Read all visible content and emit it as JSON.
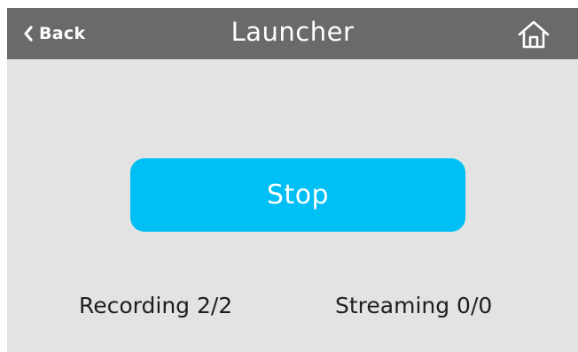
{
  "header": {
    "back_label": "Back",
    "title": "Launcher",
    "back_icon": "chevron-left-icon",
    "home_icon": "home-icon"
  },
  "main": {
    "stop_label": "Stop"
  },
  "status": {
    "recording": "Recording 2/2",
    "streaming": "Streaming 0/0"
  },
  "colors": {
    "header_bg": "#6a6a6a",
    "screen_bg": "#e3e3e3",
    "accent": "#00bff4",
    "text_light": "#ffffff",
    "text_dark": "#1e1e1e"
  }
}
